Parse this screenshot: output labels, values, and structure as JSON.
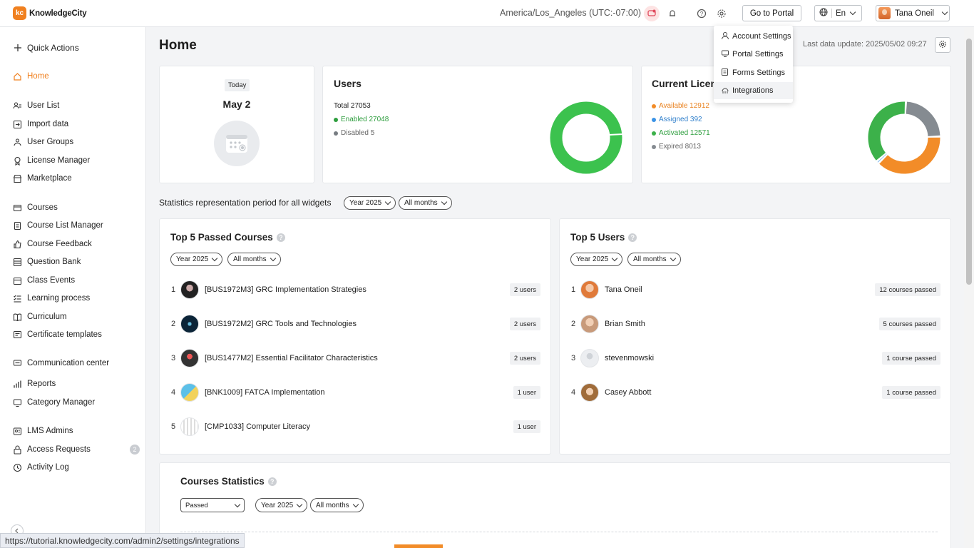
{
  "header": {
    "logo_mark": "kc",
    "logo_text": "KnowledgeCity",
    "timezone": "America/Los_Angeles (UTC:-07:00)",
    "portal_button": "Go to Portal",
    "language": "En",
    "user_name": "Tana Oneil"
  },
  "sidebar": {
    "quick_actions": "Quick Actions",
    "items": [
      {
        "label": "Home",
        "icon": "home-icon"
      },
      {
        "label": "User List",
        "icon": "users-icon"
      },
      {
        "label": "Import data",
        "icon": "import-icon"
      },
      {
        "label": "User Groups",
        "icon": "group-icon"
      },
      {
        "label": "License Manager",
        "icon": "license-icon"
      },
      {
        "label": "Marketplace",
        "icon": "store-icon"
      },
      {
        "label": "Courses",
        "icon": "courses-icon"
      },
      {
        "label": "Course List Manager",
        "icon": "doc-icon"
      },
      {
        "label": "Course Feedback",
        "icon": "thumb-icon"
      },
      {
        "label": "Question Bank",
        "icon": "bank-icon"
      },
      {
        "label": "Class Events",
        "icon": "calendar-icon"
      },
      {
        "label": "Learning process",
        "icon": "process-icon"
      },
      {
        "label": "Curriculum",
        "icon": "book-icon"
      },
      {
        "label": "Certificate templates",
        "icon": "certificate-icon"
      },
      {
        "label": "Communication center",
        "icon": "chat-icon"
      },
      {
        "label": "Reports",
        "icon": "chart-icon"
      },
      {
        "label": "Category Manager",
        "icon": "category-icon"
      },
      {
        "label": "LMS Admins",
        "icon": "admin-icon"
      },
      {
        "label": "Access Requests",
        "icon": "lock-icon"
      },
      {
        "label": "Activity Log",
        "icon": "clock-icon"
      }
    ],
    "access_requests_count": "2"
  },
  "page": {
    "title": "Home",
    "last_update": "Last data update: 2025/05/02 09:27"
  },
  "today_card": {
    "badge": "Today",
    "date": "May 2"
  },
  "users_card": {
    "title": "Users",
    "total": "Total 27053",
    "enabled": "Enabled 27048",
    "disabled": "Disabled 5",
    "colors": {
      "enabled": "#3cc24e",
      "disabled": "#777c82"
    },
    "enabled_value": 27048,
    "disabled_value": 5
  },
  "licenses_card": {
    "title": "Current Licens",
    "available": "Available 12912",
    "assigned": "Assigned 392",
    "activated": "Activated 12571",
    "expired": "Expired 8013",
    "colors": {
      "available": "#f28c28",
      "assigned": "#3b93e6",
      "activated": "#3cb14a",
      "expired": "#858b91"
    },
    "values": {
      "available": 12912,
      "assigned": 392,
      "activated": 12571,
      "expired": 8013
    }
  },
  "period": {
    "label": "Statistics representation period for all widgets",
    "year": "Year 2025",
    "months": "All months"
  },
  "top_courses": {
    "title": "Top 5 Passed Courses",
    "help": "?",
    "year": "Year 2025",
    "months": "All months",
    "rows": [
      {
        "rank": "1",
        "name": "[BUS1972M3] GRC Implementation Strategies",
        "count": "2 users"
      },
      {
        "rank": "2",
        "name": "[BUS1972M2] GRC Tools and Technologies",
        "count": "2 users"
      },
      {
        "rank": "3",
        "name": "[BUS1477M2] Essential Facilitator Characteristics",
        "count": "2 users"
      },
      {
        "rank": "4",
        "name": "[BNK1009] FATCA Implementation",
        "count": "1 user"
      },
      {
        "rank": "5",
        "name": "[CMP1033] Computer Literacy",
        "count": "1 user"
      }
    ]
  },
  "top_users": {
    "title": "Top 5 Users",
    "help": "?",
    "year": "Year 2025",
    "months": "All months",
    "rows": [
      {
        "rank": "1",
        "name": "Tana Oneil",
        "count": "12 courses passed"
      },
      {
        "rank": "2",
        "name": "Brian Smith",
        "count": "5 courses passed"
      },
      {
        "rank": "3",
        "name": "stevenmowski",
        "count": "1 course passed"
      },
      {
        "rank": "4",
        "name": "Casey Abbott",
        "count": "1 course passed"
      }
    ]
  },
  "course_stats": {
    "title": "Courses Statistics",
    "help": "?",
    "status": "Passed",
    "year": "Year 2025",
    "months": "All months"
  },
  "settings_menu": {
    "items": [
      "Account Settings",
      "Portal Settings",
      "Forms Settings",
      "Integrations"
    ]
  },
  "status_url": "https://tutorial.knowledgecity.com/admin2/settings/integrations"
}
